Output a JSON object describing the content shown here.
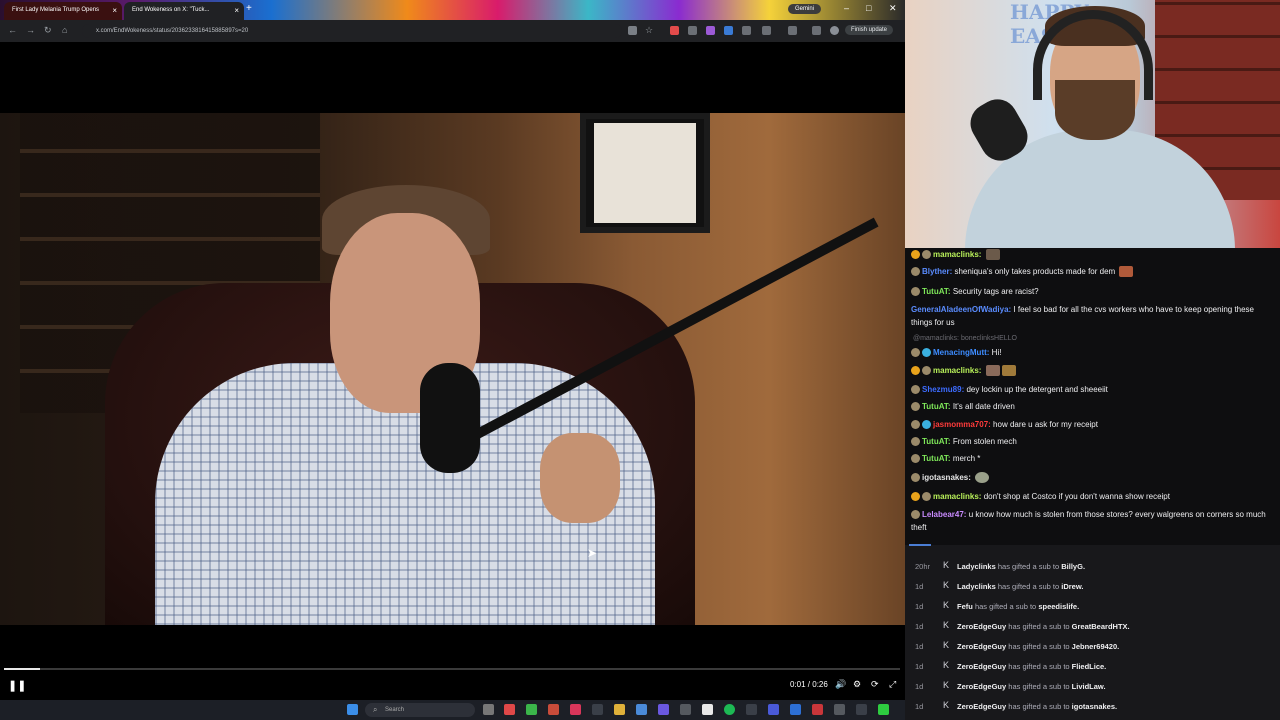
{
  "browser": {
    "tabs": [
      {
        "label": "First Lady Melania Trump Opens"
      },
      {
        "label": "End Wokeness on X: \"Tuck..."
      }
    ],
    "new_tab": "+",
    "gemini_label": "Gemini",
    "url": "x.com/EndWokeness/status/2036233816415885897s=20",
    "finish_update": "Finish update",
    "window_controls": [
      "–",
      "□",
      "✕"
    ]
  },
  "player": {
    "time": "0:01 / 0:26",
    "progress_fraction": 0.04
  },
  "taskbar": {
    "search_placeholder": "Search"
  },
  "webcam": {
    "banner": "HAPPY EASTER"
  },
  "chat": {
    "messages": [
      {
        "user": "mamaclinks:",
        "text": "",
        "color": "#b9f15a",
        "badges": [
          "#e8a21b",
          "#9b8a6a"
        ]
      },
      {
        "user": "Blyther:",
        "text": "sheniqua's only takes products made for dem",
        "color": "#5a8cff",
        "badges": [
          "#9b8a6a"
        ]
      },
      {
        "user": "TutuAT:",
        "text": "Security tags are racist?",
        "color": "#7fe85a",
        "badges": [
          "#9b8a6a"
        ]
      },
      {
        "user": "GeneralAladeenOfWadiya:",
        "text": "I feel so bad for all the cvs workers who have to keep opening these things for us",
        "color": "#5a8cff",
        "badges": []
      },
      {
        "user": "MenacingMutt:",
        "text": "Hi!",
        "color": "#3d8cff",
        "badges": [
          "#9b8a6a",
          "#3ab0e0"
        ]
      },
      {
        "user": "mamaclinks:",
        "text": "",
        "color": "#b9f15a",
        "badges": [
          "#e8a21b",
          "#9b8a6a"
        ]
      },
      {
        "user": "Shezmu89:",
        "text": "dey lockin up the detergent and sheeeiit",
        "color": "#3d6cff",
        "badges": [
          "#9b8a6a"
        ]
      },
      {
        "user": "TutuAT:",
        "text": "It's all date driven",
        "color": "#7fe85a",
        "badges": [
          "#9b8a6a"
        ]
      },
      {
        "user": "jasmomma707:",
        "text": "how dare u ask for my receipt",
        "color": "#ff3b3b",
        "badges": [
          "#9b8a6a",
          "#3ab0e0"
        ]
      },
      {
        "user": "TutuAT:",
        "text": "From stolen mech",
        "color": "#7fe85a",
        "badges": [
          "#9b8a6a"
        ]
      },
      {
        "user": "TutuAT:",
        "text": "merch *",
        "color": "#7fe85a",
        "badges": [
          "#9b8a6a"
        ]
      },
      {
        "user": "igotasnakes:",
        "text": "",
        "color": "#e6e6e6",
        "badges": [
          "#9b8a6a"
        ]
      },
      {
        "user": "mamaclinks:",
        "text": "don't shop at Costco if you don't wanna show receipt",
        "color": "#b9f15a",
        "badges": [
          "#e8a21b",
          "#9b8a6a"
        ]
      },
      {
        "user": "Lelabear47:",
        "text": "u know how much is stolen from those stores? every walgreens on corners so much theft",
        "color": "#c98bff",
        "badges": [
          "#9b8a6a"
        ]
      }
    ],
    "reply_context": "@mamaclinks: boneclinksHELLO"
  },
  "events": [
    {
      "time": "20hr",
      "user": "Ladyclinks",
      "action": "has gifted a sub to",
      "target": "BillyG."
    },
    {
      "time": "1d",
      "user": "Ladyclinks",
      "action": "has gifted a sub to",
      "target": "iDrew."
    },
    {
      "time": "1d",
      "user": "Fefu",
      "action": "has gifted a sub to",
      "target": "speedislife."
    },
    {
      "time": "1d",
      "user": "ZeroEdgeGuy",
      "action": "has gifted a sub to",
      "target": "GreatBeardHTX."
    },
    {
      "time": "1d",
      "user": "ZeroEdgeGuy",
      "action": "has gifted a sub to",
      "target": "Jebner69420."
    },
    {
      "time": "1d",
      "user": "ZeroEdgeGuy",
      "action": "has gifted a sub to",
      "target": "FliedLice."
    },
    {
      "time": "1d",
      "user": "ZeroEdgeGuy",
      "action": "has gifted a sub to",
      "target": "LividLaw."
    },
    {
      "time": "1d",
      "user": "ZeroEdgeGuy",
      "action": "has gifted a sub to",
      "target": "igotasnakes."
    }
  ]
}
